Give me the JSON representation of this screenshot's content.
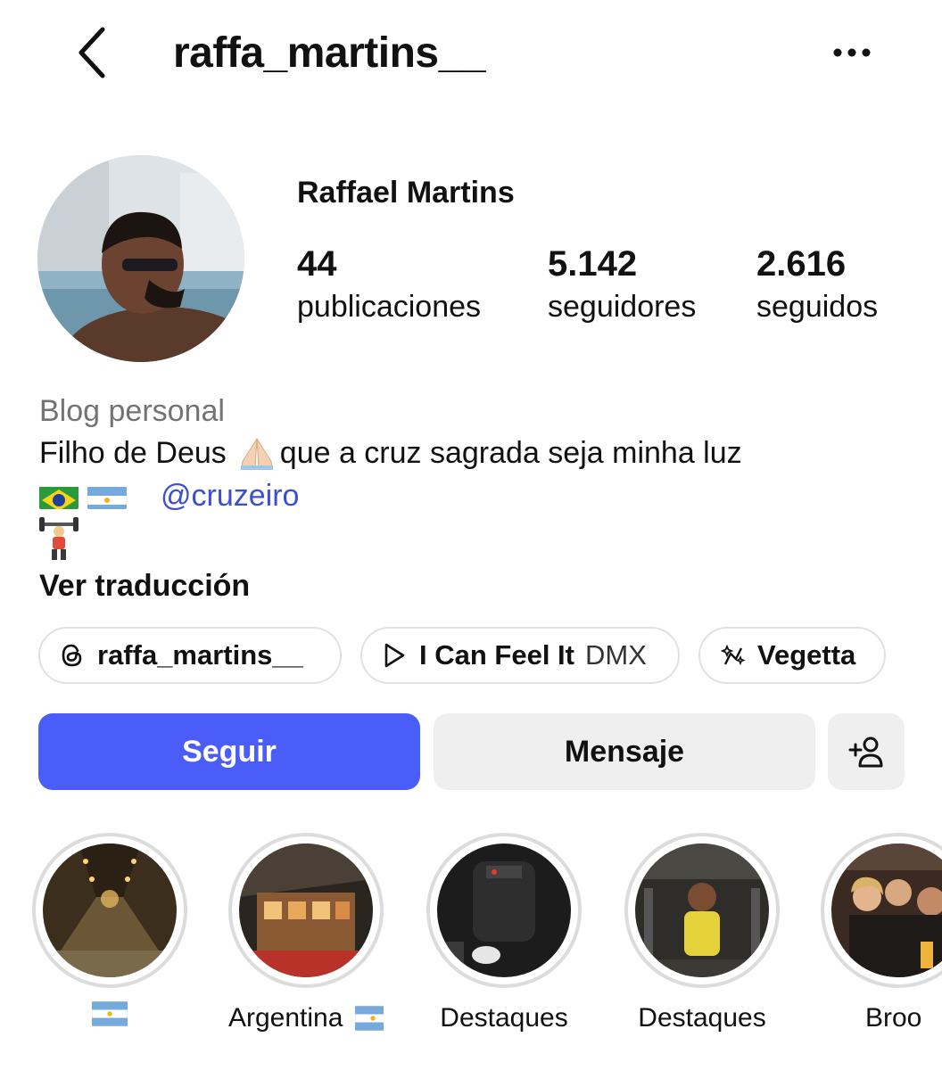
{
  "header": {
    "username": "raffa_martins__",
    "back_icon": "chevron-left-icon",
    "more_icon": "ellipsis-icon"
  },
  "profile": {
    "full_name": "Raffael Martins",
    "stats": [
      {
        "value": "44",
        "label": "publicaciones"
      },
      {
        "value": "5.142",
        "label": "seguidores"
      },
      {
        "value": "2.616",
        "label": "seguidos"
      }
    ]
  },
  "bio": {
    "category": "Blog personal",
    "line1_start": "Filho de Deus",
    "line1_end": "que a cruz sagrada seja minha luz",
    "mention": "@cruzeiro",
    "translate": "Ver traducción"
  },
  "chips": [
    {
      "icon": "threads-icon",
      "label": "raffa_martins__"
    },
    {
      "icon": "play-icon",
      "label": "I Can Feel It",
      "sub": "DMX"
    },
    {
      "icon": "sparkle-icon",
      "label": "Vegetta"
    }
  ],
  "actions": {
    "follow": "Seguir",
    "message": "Mensaje",
    "add_user_icon": "add-user-icon"
  },
  "highlights": [
    {
      "label": "",
      "flag": "argentina"
    },
    {
      "label": "Argentina",
      "flag": "argentina"
    },
    {
      "label": "Destaques"
    },
    {
      "label": "Destaques"
    },
    {
      "label": "Broo"
    }
  ],
  "colors": {
    "accent": "#4a5df9",
    "link": "#3b4fcf",
    "muted": "#737373",
    "button_bg": "#efefef"
  }
}
